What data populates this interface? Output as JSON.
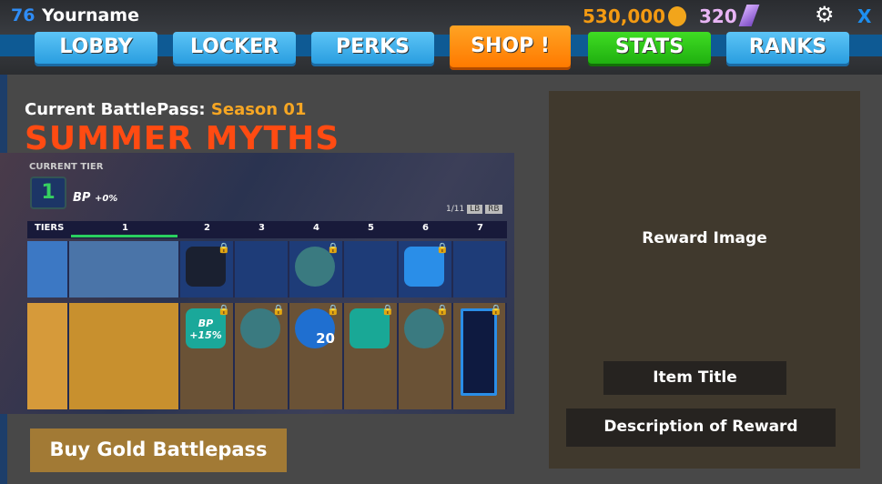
{
  "header": {
    "level": "76",
    "username": "Yourname",
    "gold": "530,000",
    "gems": "320",
    "close": "X"
  },
  "nav": [
    {
      "label": "LOBBY"
    },
    {
      "label": "LOCKER"
    },
    {
      "label": "PERKS"
    },
    {
      "label": "SHOP !"
    },
    {
      "label": "STATS"
    },
    {
      "label": "RANKS"
    }
  ],
  "battlepass": {
    "current_label": "Current BattlePass:",
    "season": "Season 01",
    "title": "SUMMER MYTHS",
    "buy_label": "Buy Gold Battlepass"
  },
  "preview": {
    "current_tier_label": "CURRENT TIER",
    "tier": "1",
    "bp_label": "BP",
    "bp_bonus": "+0%",
    "page": "1/11",
    "lb": "LB",
    "rb": "RB",
    "tiers_label": "TIERS",
    "tiers": [
      "1",
      "2",
      "3",
      "4",
      "5",
      "6",
      "7"
    ],
    "bp_reward": "BP +15%",
    "count_reward": "20"
  },
  "reward": {
    "image_label": "Reward Image",
    "item_title": "Item Title",
    "description": "Description of Reward"
  },
  "colors": {
    "shop": "#ff8a00",
    "stats": "#2ec81a",
    "nav": "#2a9ee0",
    "title": "#ff4b12"
  }
}
